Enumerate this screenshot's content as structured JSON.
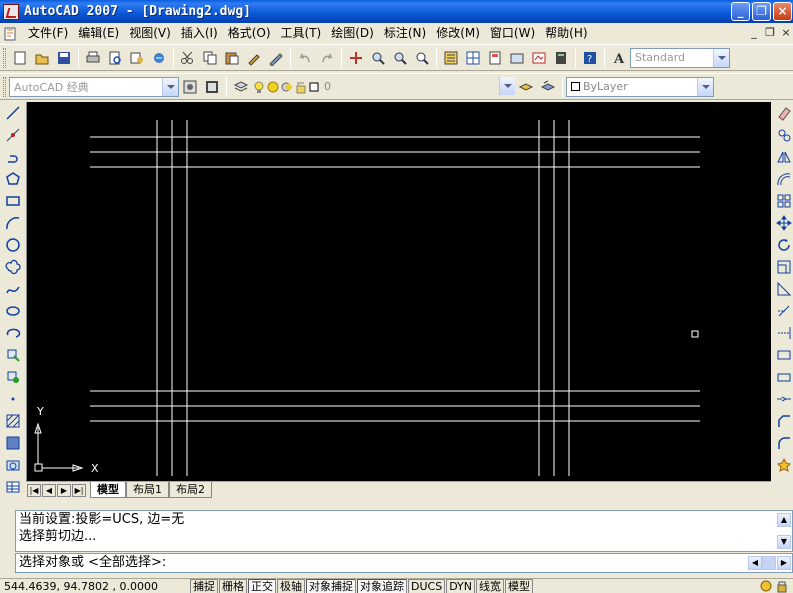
{
  "window": {
    "title": "AutoCAD 2007 - [Drawing2.dwg]"
  },
  "menu": {
    "items": [
      "文件(F)",
      "编辑(E)",
      "视图(V)",
      "插入(I)",
      "格式(O)",
      "工具(T)",
      "绘图(D)",
      "标注(N)",
      "修改(M)",
      "窗口(W)",
      "帮助(H)"
    ],
    "mdi_minimize": "_",
    "mdi_restore": "❐",
    "mdi_close": "×"
  },
  "toolbar": {
    "text_style": "Standard",
    "workspace": "AutoCAD 经典",
    "layer_value": "0",
    "linetype_value": "ByLayer"
  },
  "canvas": {
    "ucs_x_label": "X",
    "ucs_y_label": "Y",
    "background": "#000000",
    "line_color": "#ffffff"
  },
  "tabs": {
    "items": [
      "模型",
      "布局1",
      "布局2"
    ],
    "active": "模型"
  },
  "command": {
    "history": [
      "当前设置:投影=UCS, 边=无",
      "选择剪切边..."
    ],
    "prompt": "选择对象或 <全部选择>:"
  },
  "status": {
    "coords": "544.4639, 94.7802 , 0.0000",
    "buttons": [
      "捕捉",
      "栅格",
      "正交",
      "极轴",
      "对象捕捉",
      "对象追踪",
      "DUCS",
      "DYN",
      "线宽",
      "模型"
    ],
    "on_buttons": [
      "正交",
      "对象捕捉",
      "对象追踪"
    ]
  }
}
